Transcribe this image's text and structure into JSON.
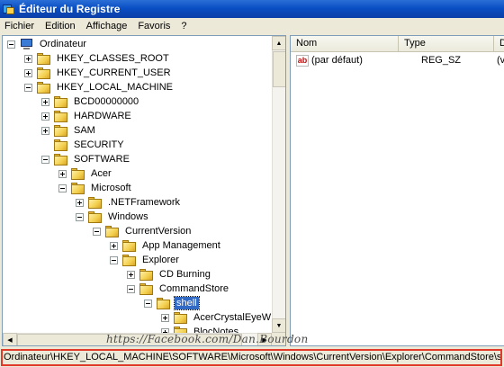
{
  "window": {
    "title": "Éditeur du Registre"
  },
  "menu": [
    "Fichier",
    "Edition",
    "Affichage",
    "Favoris",
    "?"
  ],
  "tree": [
    {
      "label": "Ordinateur",
      "icon": "computer-icon",
      "expander": "minus"
    },
    {
      "label": "HKEY_CLASSES_ROOT",
      "icon": "folder-icon",
      "expander": "plus"
    },
    {
      "label": "HKEY_CURRENT_USER",
      "icon": "folder-icon",
      "expander": "plus"
    },
    {
      "label": "HKEY_LOCAL_MACHINE",
      "icon": "folder-icon",
      "expander": "minus"
    },
    {
      "label": "BCD00000000",
      "icon": "folder-icon",
      "expander": "plus"
    },
    {
      "label": "HARDWARE",
      "icon": "folder-icon",
      "expander": "plus"
    },
    {
      "label": "SAM",
      "icon": "folder-icon",
      "expander": "plus"
    },
    {
      "label": "SECURITY",
      "icon": "folder-icon",
      "expander": "none"
    },
    {
      "label": "SOFTWARE",
      "icon": "folder-icon",
      "expander": "minus"
    },
    {
      "label": "Acer",
      "icon": "folder-icon",
      "expander": "plus"
    },
    {
      "label": "Microsoft",
      "icon": "folder-icon",
      "expander": "minus"
    },
    {
      "label": ".NETFramework",
      "icon": "folder-icon",
      "expander": "plus"
    },
    {
      "label": "Windows",
      "icon": "folder-icon",
      "expander": "minus"
    },
    {
      "label": "CurrentVersion",
      "icon": "folder-icon",
      "expander": "minus"
    },
    {
      "label": "App Management",
      "icon": "folder-icon",
      "expander": "plus"
    },
    {
      "label": "Explorer",
      "icon": "folder-icon",
      "expander": "minus"
    },
    {
      "label": "CD Burning",
      "icon": "folder-icon",
      "expander": "plus"
    },
    {
      "label": "CommandStore",
      "icon": "folder-icon",
      "expander": "minus"
    },
    {
      "label": "shell",
      "icon": "folder-icon",
      "expander": "minus",
      "selected": true
    },
    {
      "label": "AcerCrystalEyeW",
      "icon": "folder-icon",
      "expander": "plus"
    },
    {
      "label": "BlocNotes",
      "icon": "folder-icon",
      "expander": "plus"
    }
  ],
  "list": {
    "columns": [
      "Nom",
      "Type",
      "Donn"
    ],
    "rows": [
      {
        "name": "(par défaut)",
        "type": "REG_SZ",
        "data": "(v",
        "icon": "string-value-icon"
      }
    ]
  },
  "watermark": "https://Facebook.com/Dan.Bourdon",
  "status": {
    "path": "Ordinateur\\HKEY_LOCAL_MACHINE\\SOFTWARE\\Microsoft\\Windows\\CurrentVersion\\Explorer\\CommandStore\\shell"
  },
  "colors": {
    "title_bar": "#0a4fc4",
    "selection": "#316ac5",
    "status_highlight": "#e23a2a"
  }
}
